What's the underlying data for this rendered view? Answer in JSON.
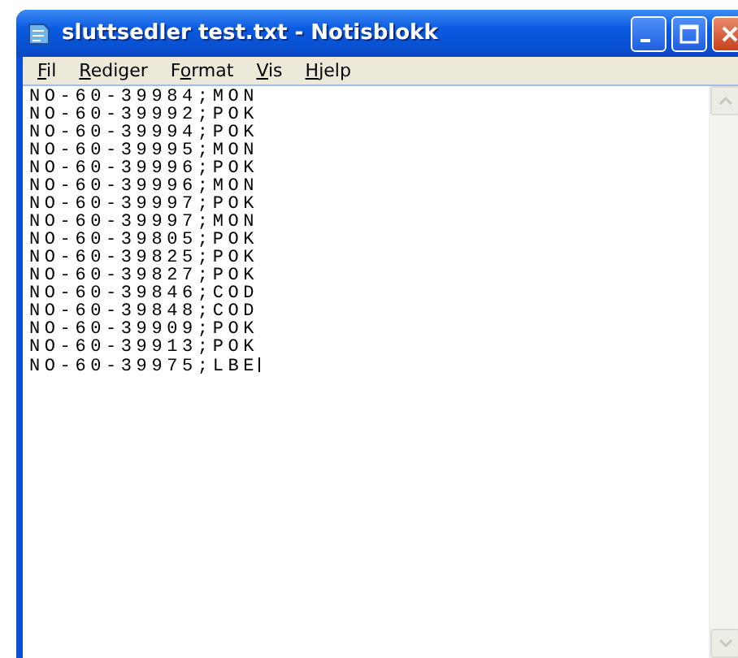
{
  "window": {
    "title": "sluttsedler test.txt - Notisblokk"
  },
  "menu": [
    {
      "access_key": "F",
      "after": "il"
    },
    {
      "access_key": "R",
      "after": "ediger"
    },
    {
      "before": "F",
      "access_key": "o",
      "after": "rmat"
    },
    {
      "access_key": "V",
      "after": "is"
    },
    {
      "access_key": "H",
      "after": "jelp"
    }
  ],
  "editor": {
    "lines": [
      "NO-60-39984;MON",
      "NO-60-39992;POK",
      "NO-60-39994;POK",
      "NO-60-39995;MON",
      "NO-60-39996;POK",
      "NO-60-39996;MON",
      "NO-60-39997;POK",
      "NO-60-39997;MON",
      "NO-60-39805;POK",
      "NO-60-39825;POK",
      "NO-60-39827;POK",
      "NO-60-39846;COD",
      "NO-60-39848;COD",
      "NO-60-39909;POK",
      "NO-60-39913;POK",
      "NO-60-39975;LBE"
    ]
  }
}
